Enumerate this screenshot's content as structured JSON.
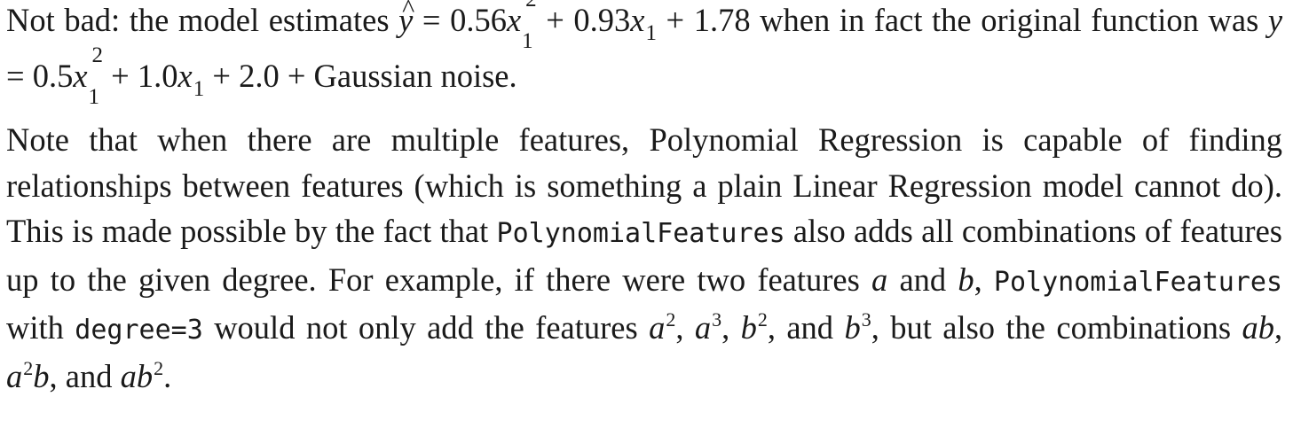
{
  "paragraph1": {
    "text_start": "Not bad: the model estimates",
    "yhat": "y",
    "eq": "=",
    "c1": "0.56",
    "var": "x",
    "sub1": "1",
    "exp2": "2",
    "plus": "+",
    "c2": "0.93",
    "c3": "1.78",
    "mid": "when in fact the original function was",
    "y": "y",
    "d1": "0.5",
    "d2": "1.0",
    "d3": "2.0",
    "noise": "Gaussian noise."
  },
  "paragraph2": {
    "t1": "Note that when there are multiple features, Polynomial Regression is capable of find­ing relationships between features (which is something a plain Linear Regression model cannot do). This is made possible by the fact that",
    "code1": "PolynomialFeatures",
    "t2": "also adds all combinations of features up to the given degree. For example, if there were two features",
    "a": "a",
    "and": "and",
    "b": "b",
    "comma": ",",
    "code2": "PolynomialFeatures",
    "with": "with",
    "code3": "degree=3",
    "t3": "would not only add the features",
    "sq": "2",
    "cube": "3",
    "t4": "but also the combinations",
    "ab": "ab",
    "final_and": "and",
    "period": "."
  }
}
